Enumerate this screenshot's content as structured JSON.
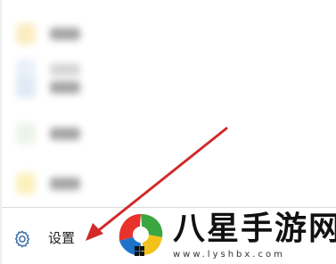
{
  "menu": {
    "items": [
      {
        "icon": "blurred-app-icon",
        "color": "#fbe9b7"
      },
      {
        "icon": "blurred-app-icon",
        "color": "#e6eef8"
      },
      {
        "icon": "blurred-app-icon",
        "color": "#dbe6f3"
      },
      {
        "icon": "blurred-app-icon",
        "color": "#e9f3e6"
      },
      {
        "icon": "blurred-app-icon",
        "color": "#fbeeb0"
      }
    ],
    "settings": {
      "label": "设置",
      "icon": "gear-icon",
      "icon_color": "#3a6ea5"
    }
  },
  "annotation": {
    "arrow_color": "#d12a2a"
  },
  "watermark": {
    "title": "八星手游网",
    "url": "www.lyshbx.com",
    "logo_colors": [
      "#e8322b",
      "#3aa63f",
      "#1e73c9",
      "#f2c21a"
    ]
  }
}
